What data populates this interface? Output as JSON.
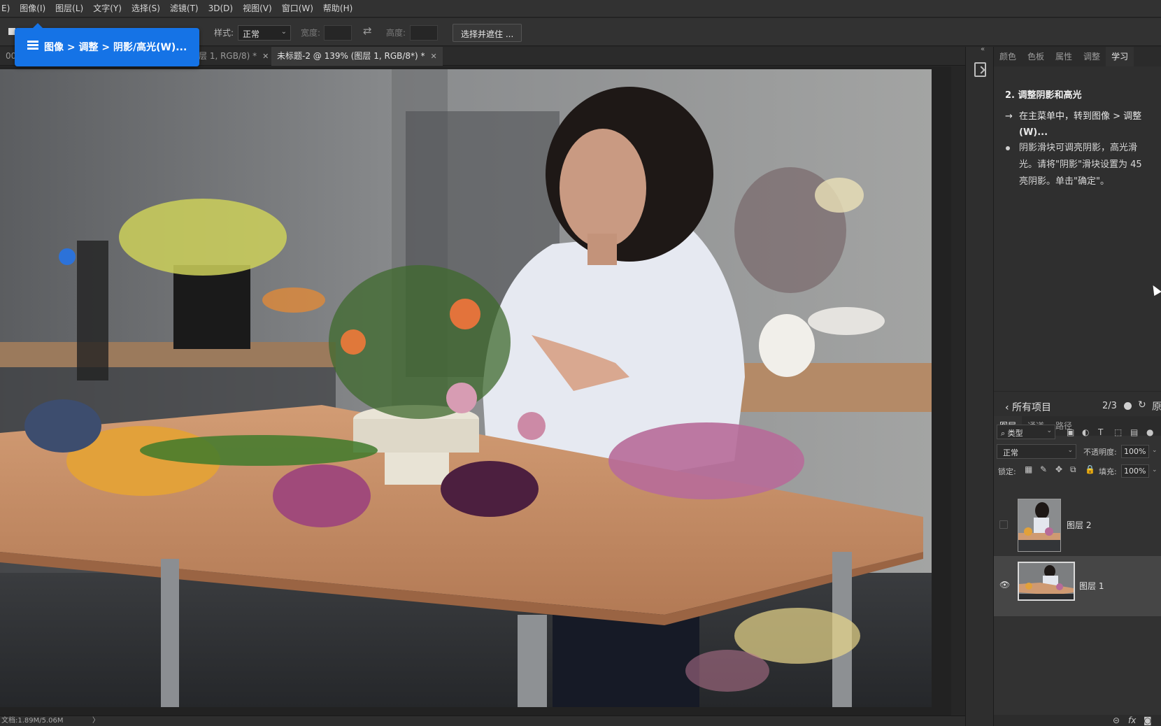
{
  "menu": [
    "E)",
    "图像(I)",
    "图层(L)",
    "文字(Y)",
    "选择(S)",
    "滤镜(T)",
    "3D(D)",
    "视图(V)",
    "窗口(W)",
    "帮助(H)"
  ],
  "options": {
    "style_label": "样式:",
    "style_value": "正常",
    "width_label": "宽度:",
    "height_label": "高度:",
    "select_mask_button": "选择并遮住 ..."
  },
  "tooltip": {
    "text": "图像 > 调整 > 阴影/高光(W)..."
  },
  "tabs": [
    {
      "label": "00%",
      "active": false
    },
    {
      "label": "层 1, RGB/8) *",
      "active": false
    },
    {
      "label": "未标题-2 @ 139% (图层 1, RGB/8*) *",
      "active": true
    }
  ],
  "status": {
    "doc_info": "文档:1.89M/5.06M",
    "arrow": "〉"
  },
  "top_panel_tabs": [
    {
      "label": "颜色",
      "active": false
    },
    {
      "label": "色板",
      "active": false
    },
    {
      "label": "属性",
      "active": false
    },
    {
      "label": "调整",
      "active": false
    },
    {
      "label": "学习",
      "active": true
    }
  ],
  "learn": {
    "step_title": "2.  调整阴影和高光",
    "instruction_arrow": "→",
    "instruction_line1": "在主菜单中，转到图像 > 调整",
    "instruction_line2": "(W)...",
    "note_line1": "阴影滑块可调亮阴影，高光滑",
    "note_line2": "光。请将\"阴影\"滑块设置为 45",
    "note_line3": "亮阴影。单击\"确定\"。",
    "back_label": "所有项目",
    "step_count": "2/3",
    "reset_glyph": "↻",
    "trailing_glyph": "原"
  },
  "layers_panel_tabs": [
    {
      "label": "图层",
      "active": true
    },
    {
      "label": "通道",
      "active": false
    },
    {
      "label": "路径",
      "active": false
    }
  ],
  "layers_controls": {
    "filter_value": "类型",
    "blend_mode": "正常",
    "opacity_label": "不透明度:",
    "opacity_value": "100%",
    "lock_label": "锁定:",
    "fill_label": "填充:",
    "fill_value": "100%"
  },
  "layers": [
    {
      "name": "图层 2",
      "visible": false,
      "selected": false
    },
    {
      "name": "图层 1",
      "visible": true,
      "selected": true
    }
  ],
  "panel_bottom_icons": [
    "link-icon",
    "fx-icon",
    "mask-icon"
  ],
  "panel_bottom_fx": "fx",
  "colors": {
    "accent_blue": "#1573e6",
    "panel_bg": "#323232",
    "menubar_bg": "#323232",
    "workspace_bg": "#222222"
  }
}
